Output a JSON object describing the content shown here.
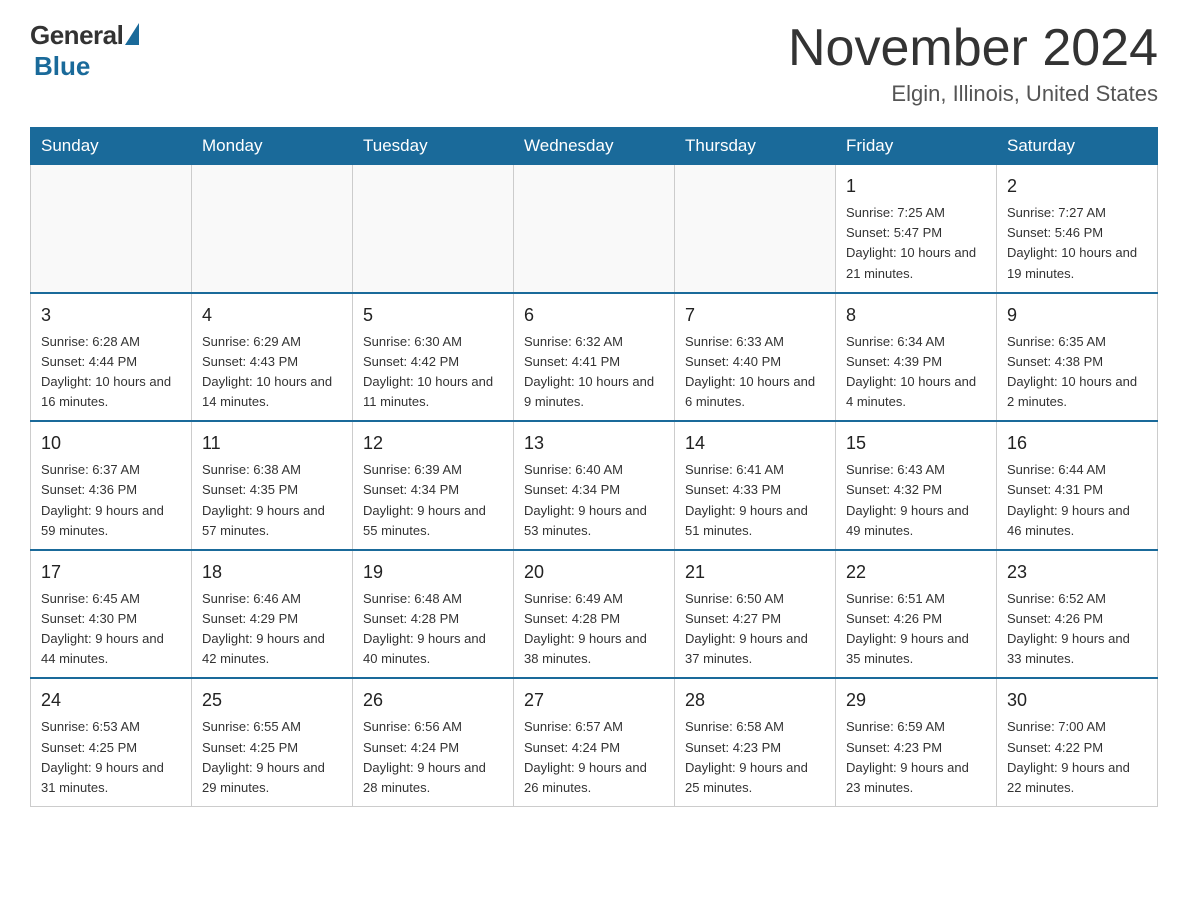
{
  "header": {
    "logo": {
      "general": "General",
      "blue": "Blue"
    },
    "title": "November 2024",
    "subtitle": "Elgin, Illinois, United States"
  },
  "days_of_week": [
    "Sunday",
    "Monday",
    "Tuesday",
    "Wednesday",
    "Thursday",
    "Friday",
    "Saturday"
  ],
  "weeks": [
    {
      "days": [
        {
          "num": "",
          "info": ""
        },
        {
          "num": "",
          "info": ""
        },
        {
          "num": "",
          "info": ""
        },
        {
          "num": "",
          "info": ""
        },
        {
          "num": "",
          "info": ""
        },
        {
          "num": "1",
          "info": "Sunrise: 7:25 AM\nSunset: 5:47 PM\nDaylight: 10 hours and 21 minutes."
        },
        {
          "num": "2",
          "info": "Sunrise: 7:27 AM\nSunset: 5:46 PM\nDaylight: 10 hours and 19 minutes."
        }
      ]
    },
    {
      "days": [
        {
          "num": "3",
          "info": "Sunrise: 6:28 AM\nSunset: 4:44 PM\nDaylight: 10 hours and 16 minutes."
        },
        {
          "num": "4",
          "info": "Sunrise: 6:29 AM\nSunset: 4:43 PM\nDaylight: 10 hours and 14 minutes."
        },
        {
          "num": "5",
          "info": "Sunrise: 6:30 AM\nSunset: 4:42 PM\nDaylight: 10 hours and 11 minutes."
        },
        {
          "num": "6",
          "info": "Sunrise: 6:32 AM\nSunset: 4:41 PM\nDaylight: 10 hours and 9 minutes."
        },
        {
          "num": "7",
          "info": "Sunrise: 6:33 AM\nSunset: 4:40 PM\nDaylight: 10 hours and 6 minutes."
        },
        {
          "num": "8",
          "info": "Sunrise: 6:34 AM\nSunset: 4:39 PM\nDaylight: 10 hours and 4 minutes."
        },
        {
          "num": "9",
          "info": "Sunrise: 6:35 AM\nSunset: 4:38 PM\nDaylight: 10 hours and 2 minutes."
        }
      ]
    },
    {
      "days": [
        {
          "num": "10",
          "info": "Sunrise: 6:37 AM\nSunset: 4:36 PM\nDaylight: 9 hours and 59 minutes."
        },
        {
          "num": "11",
          "info": "Sunrise: 6:38 AM\nSunset: 4:35 PM\nDaylight: 9 hours and 57 minutes."
        },
        {
          "num": "12",
          "info": "Sunrise: 6:39 AM\nSunset: 4:34 PM\nDaylight: 9 hours and 55 minutes."
        },
        {
          "num": "13",
          "info": "Sunrise: 6:40 AM\nSunset: 4:34 PM\nDaylight: 9 hours and 53 minutes."
        },
        {
          "num": "14",
          "info": "Sunrise: 6:41 AM\nSunset: 4:33 PM\nDaylight: 9 hours and 51 minutes."
        },
        {
          "num": "15",
          "info": "Sunrise: 6:43 AM\nSunset: 4:32 PM\nDaylight: 9 hours and 49 minutes."
        },
        {
          "num": "16",
          "info": "Sunrise: 6:44 AM\nSunset: 4:31 PM\nDaylight: 9 hours and 46 minutes."
        }
      ]
    },
    {
      "days": [
        {
          "num": "17",
          "info": "Sunrise: 6:45 AM\nSunset: 4:30 PM\nDaylight: 9 hours and 44 minutes."
        },
        {
          "num": "18",
          "info": "Sunrise: 6:46 AM\nSunset: 4:29 PM\nDaylight: 9 hours and 42 minutes."
        },
        {
          "num": "19",
          "info": "Sunrise: 6:48 AM\nSunset: 4:28 PM\nDaylight: 9 hours and 40 minutes."
        },
        {
          "num": "20",
          "info": "Sunrise: 6:49 AM\nSunset: 4:28 PM\nDaylight: 9 hours and 38 minutes."
        },
        {
          "num": "21",
          "info": "Sunrise: 6:50 AM\nSunset: 4:27 PM\nDaylight: 9 hours and 37 minutes."
        },
        {
          "num": "22",
          "info": "Sunrise: 6:51 AM\nSunset: 4:26 PM\nDaylight: 9 hours and 35 minutes."
        },
        {
          "num": "23",
          "info": "Sunrise: 6:52 AM\nSunset: 4:26 PM\nDaylight: 9 hours and 33 minutes."
        }
      ]
    },
    {
      "days": [
        {
          "num": "24",
          "info": "Sunrise: 6:53 AM\nSunset: 4:25 PM\nDaylight: 9 hours and 31 minutes."
        },
        {
          "num": "25",
          "info": "Sunrise: 6:55 AM\nSunset: 4:25 PM\nDaylight: 9 hours and 29 minutes."
        },
        {
          "num": "26",
          "info": "Sunrise: 6:56 AM\nSunset: 4:24 PM\nDaylight: 9 hours and 28 minutes."
        },
        {
          "num": "27",
          "info": "Sunrise: 6:57 AM\nSunset: 4:24 PM\nDaylight: 9 hours and 26 minutes."
        },
        {
          "num": "28",
          "info": "Sunrise: 6:58 AM\nSunset: 4:23 PM\nDaylight: 9 hours and 25 minutes."
        },
        {
          "num": "29",
          "info": "Sunrise: 6:59 AM\nSunset: 4:23 PM\nDaylight: 9 hours and 23 minutes."
        },
        {
          "num": "30",
          "info": "Sunrise: 7:00 AM\nSunset: 4:22 PM\nDaylight: 9 hours and 22 minutes."
        }
      ]
    }
  ]
}
